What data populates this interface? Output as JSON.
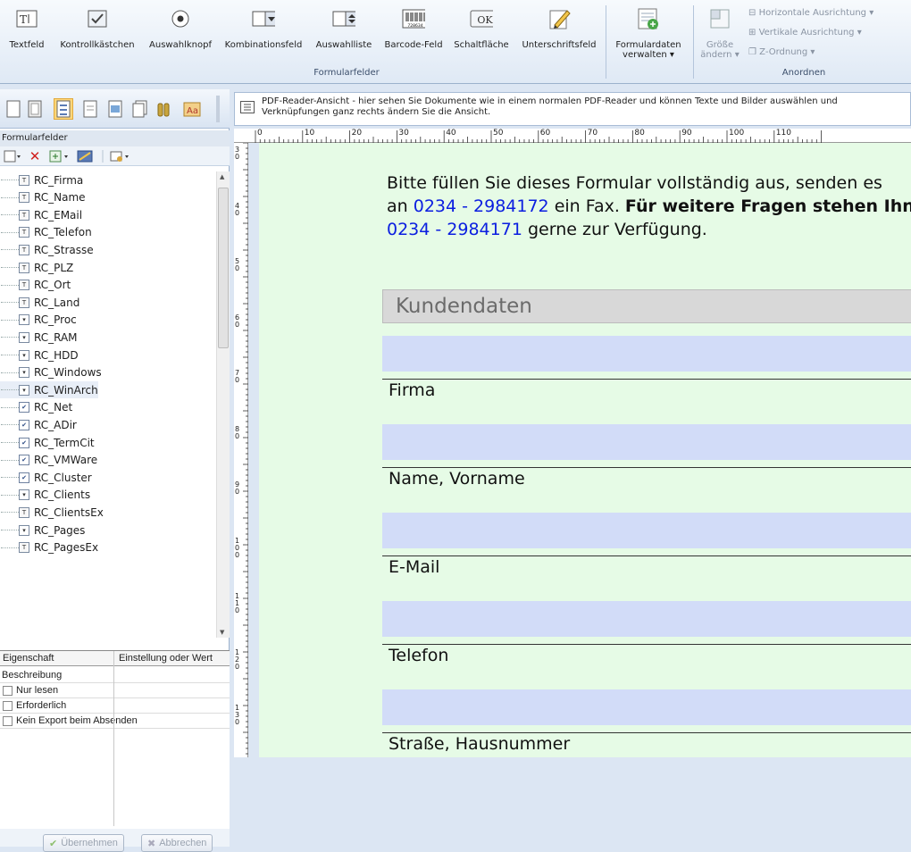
{
  "ribbon": {
    "tools": [
      {
        "label": "Textfeld",
        "icon": "textfield-icon"
      },
      {
        "label": "Kontrollkästchen",
        "icon": "checkbox-icon"
      },
      {
        "label": "Auswahlknopf",
        "icon": "radio-icon"
      },
      {
        "label": "Kombinationsfeld",
        "icon": "combobox-icon"
      },
      {
        "label": "Auswahlliste",
        "icon": "listbox-icon"
      },
      {
        "label": "Barcode-Feld",
        "icon": "barcode-icon"
      },
      {
        "label": "Schaltfläche",
        "icon": "button-icon"
      },
      {
        "label": "Unterschriftsfeld",
        "icon": "signature-icon"
      }
    ],
    "group_formularfelder": "Formularfelder",
    "formulardaten_line1": "Formulardaten",
    "formulardaten_line2": "verwalten",
    "groesse_line1": "Größe",
    "groesse_line2": "ändern",
    "horizontal": "Horizontale Ausrichtung",
    "vertical": "Vertikale Ausrichtung",
    "zorder": "Z-Ordnung",
    "group_anordnen": "Anordnen",
    "combo_ok_text": "OK",
    "barcode_text": "728634"
  },
  "panel": {
    "title": "Formularfelder",
    "fields": [
      {
        "name": "RC_Firma",
        "type": "text"
      },
      {
        "name": "RC_Name",
        "type": "text"
      },
      {
        "name": "RC_EMail",
        "type": "text"
      },
      {
        "name": "RC_Telefon",
        "type": "text"
      },
      {
        "name": "RC_Strasse",
        "type": "text"
      },
      {
        "name": "RC_PLZ",
        "type": "text"
      },
      {
        "name": "RC_Ort",
        "type": "text"
      },
      {
        "name": "RC_Land",
        "type": "text"
      },
      {
        "name": "RC_Proc",
        "type": "combo"
      },
      {
        "name": "RC_RAM",
        "type": "combo"
      },
      {
        "name": "RC_HDD",
        "type": "combo"
      },
      {
        "name": "RC_Windows",
        "type": "combo"
      },
      {
        "name": "RC_WinArch",
        "type": "combo"
      },
      {
        "name": "RC_Net",
        "type": "check"
      },
      {
        "name": "RC_ADir",
        "type": "check"
      },
      {
        "name": "RC_TermCit",
        "type": "check"
      },
      {
        "name": "RC_VMWare",
        "type": "check"
      },
      {
        "name": "RC_Cluster",
        "type": "check"
      },
      {
        "name": "RC_Clients",
        "type": "combo"
      },
      {
        "name": "RC_ClientsEx",
        "type": "text"
      },
      {
        "name": "RC_Pages",
        "type": "combo"
      },
      {
        "name": "RC_PagesEx",
        "type": "text"
      }
    ]
  },
  "props": {
    "col1": "Eigenschaft",
    "col2": "Einstellung oder Wert",
    "beschreibung": "Beschreibung",
    "nur_lesen": "Nur lesen",
    "erforderlich": "Erforderlich",
    "kein_export": "Kein Export beim Absenden",
    "apply": "Übernehmen",
    "cancel": "Abbrechen"
  },
  "info": {
    "line1": "PDF-Reader-Ansicht - hier sehen Sie Dokumente wie in einem normalen PDF-Reader und können Texte und Bilder auswählen und",
    "line2": "Verknüpfungen ganz rechts ändern Sie die Ansicht."
  },
  "ruler": {
    "ticks": [
      "0",
      "10",
      "20",
      "30",
      "40",
      "50",
      "60",
      "70",
      "80",
      "90",
      "100",
      "110"
    ],
    "vticks": [
      "3\n0",
      "4\n0",
      "5\n0",
      "6\n0",
      "7\n0",
      "8\n0",
      "9\n0",
      "1\n0\n0",
      "1\n1\n0",
      "1\n2\n0",
      "1\n3\n0"
    ]
  },
  "document": {
    "intro_line1": "Bitte füllen Sie dieses Formular vollständig aus, senden es",
    "intro_l2_pre": "an",
    "phone_fax": "0234 - 2984172",
    "intro_l2_mid": "ein Fax.",
    "intro_l2_bold": "Für weitere Fragen stehen Ihn",
    "phone_contact": "0234 - 2984171",
    "intro_l3_post": "gerne zur Verfügung.",
    "section": "Kundendaten",
    "fields": [
      "Firma",
      "Name, Vorname",
      "E-Mail",
      "Telefon",
      "Straße, Hausnummer"
    ]
  }
}
